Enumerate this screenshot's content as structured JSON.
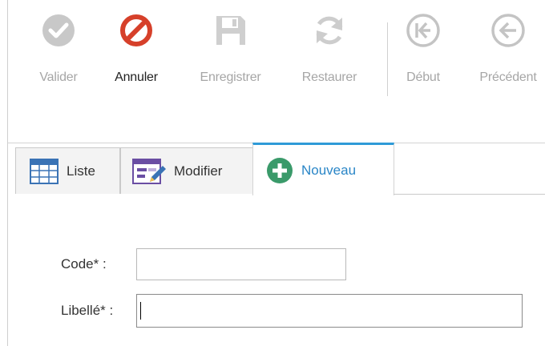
{
  "toolbar": {
    "buttons": [
      {
        "id": "valider",
        "label": "Valider",
        "state": "disabled",
        "icon": "check-circle-icon"
      },
      {
        "id": "annuler",
        "label": "Annuler",
        "state": "enabled",
        "icon": "cancel-circle-icon",
        "color": "#d6402a"
      },
      {
        "id": "enregistrer",
        "label": "Enregistrer",
        "state": "disabled",
        "icon": "save-icon"
      },
      {
        "id": "restaurer",
        "label": "Restaurer",
        "state": "disabled",
        "icon": "refresh-icon"
      },
      {
        "id": "debut",
        "label": "Début",
        "state": "disabled",
        "icon": "first-icon"
      },
      {
        "id": "precedent",
        "label": "Précédent",
        "state": "disabled",
        "icon": "previous-icon"
      }
    ]
  },
  "tabs": [
    {
      "label": "Liste",
      "icon": "table-icon"
    },
    {
      "label": "Modifier",
      "icon": "edit-form-icon"
    },
    {
      "label": "Nouveau",
      "icon": "add-circle-icon",
      "active": true,
      "color": "#2f9bd8"
    }
  ],
  "form": {
    "code": {
      "label": "Code* :",
      "value": ""
    },
    "libelle": {
      "label": "Libellé* :",
      "value": ""
    }
  },
  "colors": {
    "accent": "#2f9bd8",
    "cancel": "#d6402a",
    "add": "#3a9a6a",
    "disabled": "#c4c4c4"
  }
}
